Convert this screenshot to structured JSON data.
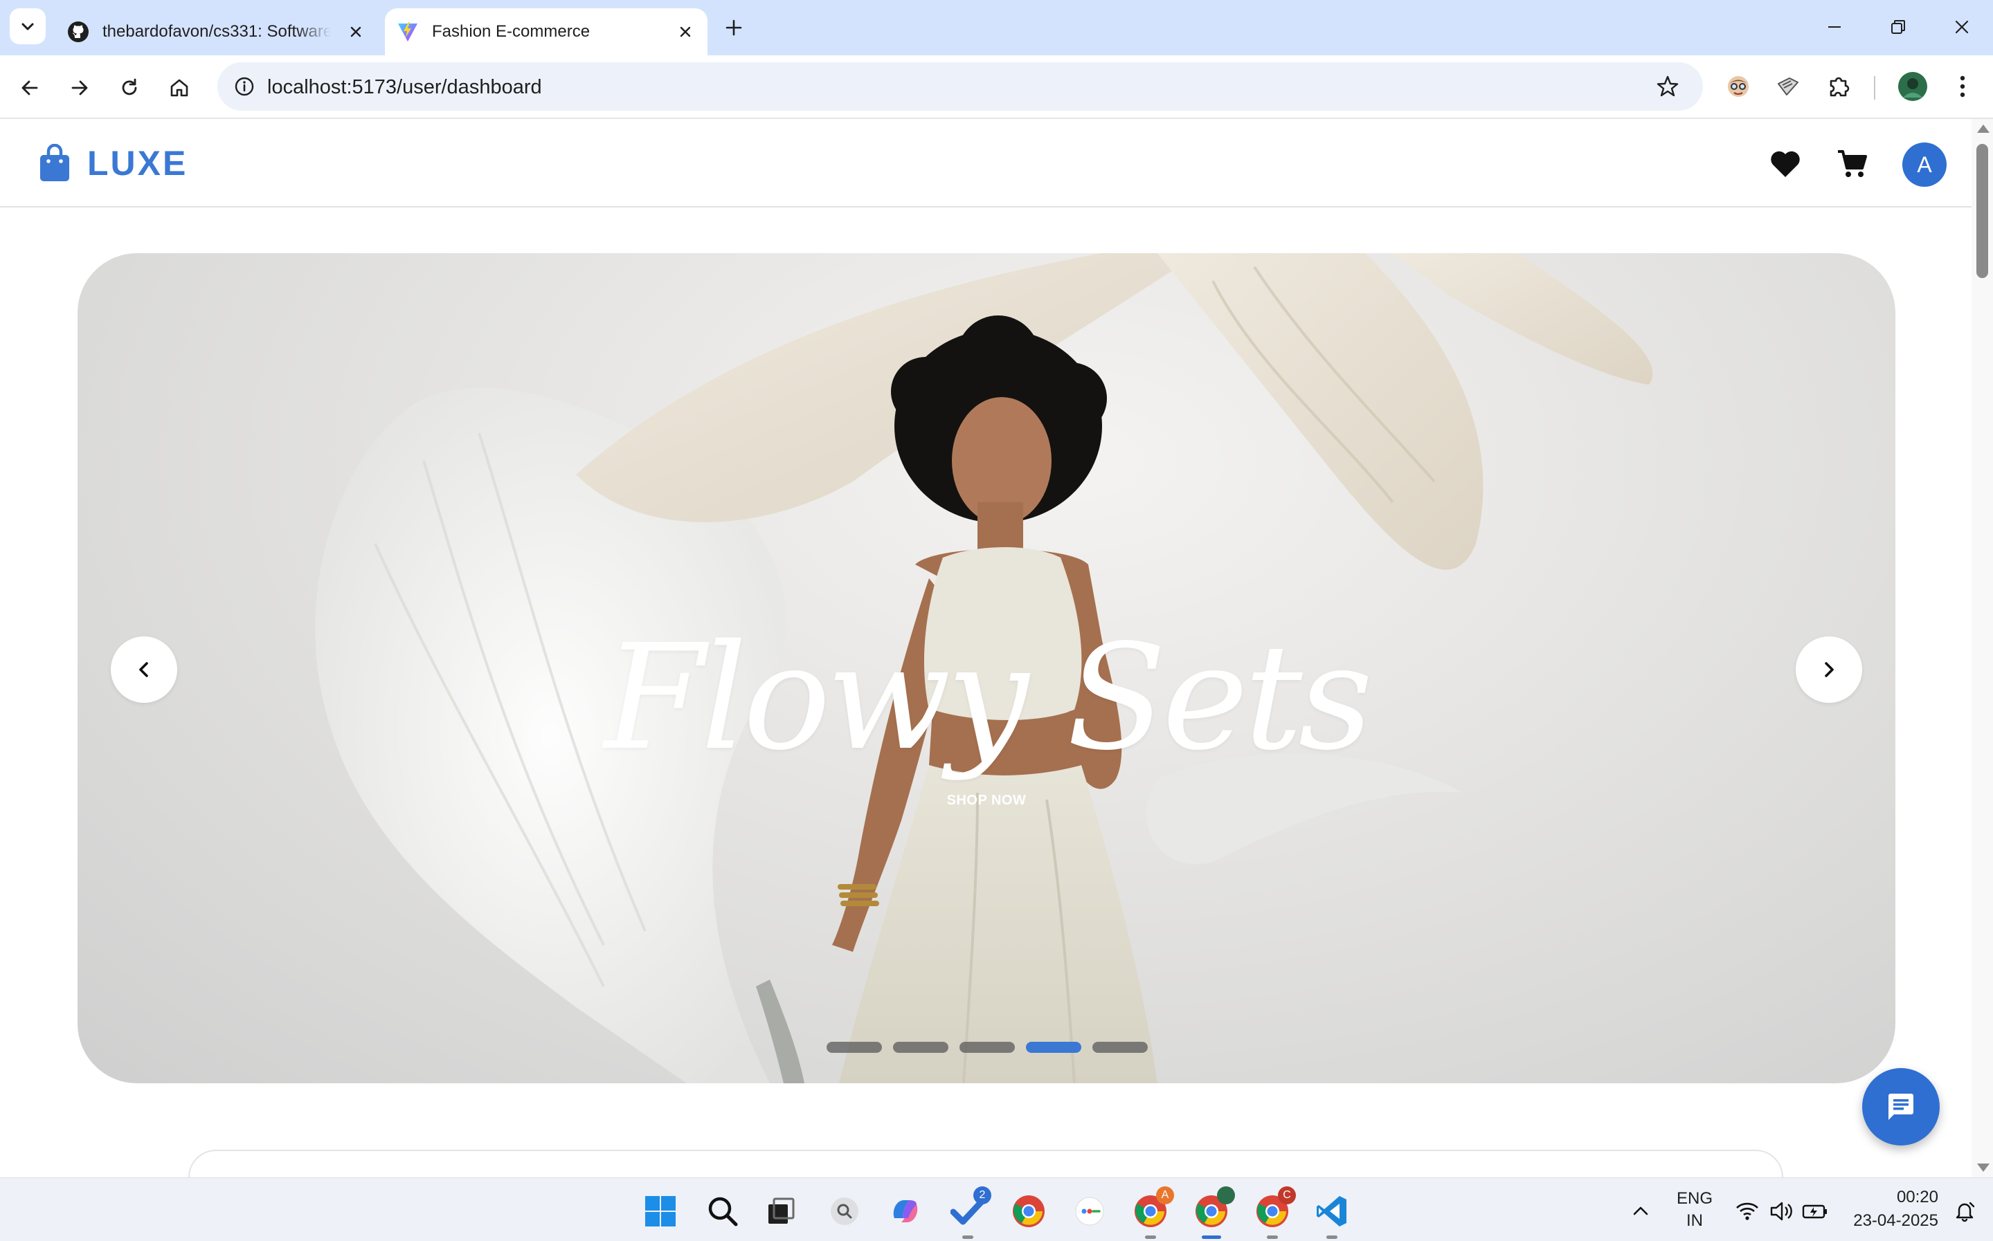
{
  "browser": {
    "tabs": [
      {
        "title": "thebardofavon/cs331: Software",
        "active": false
      },
      {
        "title": "Fashion E-commerce",
        "active": true
      }
    ],
    "url": "localhost:5173/user/dashboard"
  },
  "site": {
    "logo_text": "LUXE",
    "avatar_initial": "A",
    "brand_color": "#3a78d4"
  },
  "hero": {
    "title": "Flowy Sets",
    "cta": "SHOP NOW",
    "slide_count": 5,
    "active_slide": 4
  },
  "taskbar": {
    "todo_badge": "2",
    "chrome_profile_badge_a": "A",
    "chrome_profile_badge_c": "C",
    "language": "ENG",
    "region": "IN",
    "time": "00:20",
    "date": "23-04-2025"
  }
}
